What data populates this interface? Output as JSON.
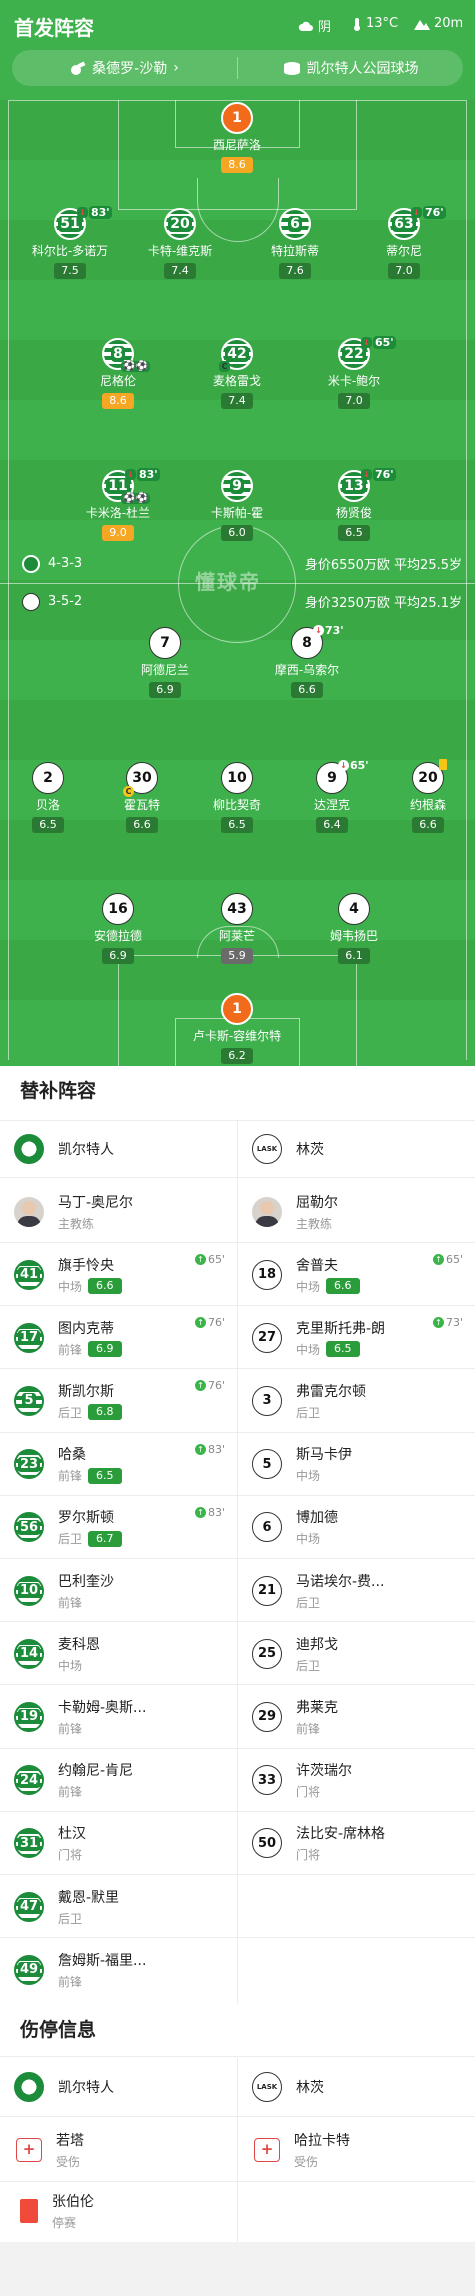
{
  "header": {
    "title": "首发阵容",
    "weather": "阴",
    "temperature": "13°C",
    "wind": "20m"
  },
  "info": {
    "referee": "桑德罗-沙勒",
    "stadium": "凯尔特人公园球场"
  },
  "watermark": "懂球帝",
  "home": {
    "formation": "4-3-3",
    "meta": "身价6550万欧  平均25.5岁",
    "players": [
      {
        "num": "1",
        "name": "西尼萨洛",
        "rating": "8.6",
        "best": true,
        "gk": true
      },
      {
        "num": "51",
        "name": "科尔比-多诺万",
        "rating": "7.5",
        "sub": "83'"
      },
      {
        "num": "20",
        "name": "卡特-维克斯",
        "rating": "7.4"
      },
      {
        "num": "6",
        "name": "特拉斯蒂",
        "rating": "7.6"
      },
      {
        "num": "63",
        "name": "蒂尔尼",
        "rating": "7.0",
        "sub": "76'"
      },
      {
        "num": "8",
        "name": "尼格伦",
        "rating": "8.6",
        "best": true
      },
      {
        "num": "42",
        "name": "麦格雷戈",
        "rating": "7.4"
      },
      {
        "num": "22",
        "name": "米卡-鲍尔",
        "rating": "7.0",
        "sub": "65'"
      },
      {
        "num": "11",
        "name": "卡米洛-杜兰",
        "rating": "9.0",
        "best": true,
        "sub": "83'"
      },
      {
        "num": "9",
        "name": "卡斯帕-霍",
        "rating": "6.0"
      },
      {
        "num": "13",
        "name": "杨贤俊",
        "rating": "6.5",
        "sub": "76'"
      }
    ]
  },
  "away": {
    "formation": "3-5-2",
    "meta": "身价3250万欧  平均25.1岁",
    "players": [
      {
        "num": "7",
        "name": "阿德尼兰",
        "rating": "6.9"
      },
      {
        "num": "8",
        "name": "摩西-乌索尔",
        "rating": "6.6",
        "sub": "73'"
      },
      {
        "num": "2",
        "name": "贝洛",
        "rating": "6.5"
      },
      {
        "num": "30",
        "name": "霍瓦特",
        "rating": "6.6"
      },
      {
        "num": "10",
        "name": "柳比契奇",
        "rating": "6.5"
      },
      {
        "num": "9",
        "name": "达涅克",
        "rating": "6.4",
        "sub": "65'"
      },
      {
        "num": "20",
        "name": "约根森",
        "rating": "6.6"
      },
      {
        "num": "16",
        "name": "安德拉德",
        "rating": "6.9"
      },
      {
        "num": "43",
        "name": "阿莱芒",
        "rating": "5.9",
        "low": true
      },
      {
        "num": "4",
        "name": "姆韦扬巴",
        "rating": "6.1"
      },
      {
        "num": "1",
        "name": "卢卡斯-容维尔特",
        "rating": "6.2",
        "gk": true
      }
    ]
  },
  "subs": {
    "title": "替补阵容",
    "home_team": "凯尔特人",
    "away_team": "林茨",
    "away_logo_text": "LASK",
    "home_coach": {
      "name": "马丁-奥尼尔",
      "role": "主教练"
    },
    "away_coach": {
      "name": "屈勒尔",
      "role": "主教练"
    },
    "home": [
      {
        "num": "41",
        "name": "旗手怜央",
        "pos": "中场",
        "rating": "6.6",
        "in": "65'"
      },
      {
        "num": "17",
        "name": "图内克蒂",
        "pos": "前锋",
        "rating": "6.9",
        "in": "76'"
      },
      {
        "num": "5",
        "name": "斯凯尔斯",
        "pos": "后卫",
        "rating": "6.8",
        "in": "76'"
      },
      {
        "num": "23",
        "name": "哈桑",
        "pos": "前锋",
        "rating": "6.5",
        "in": "83'"
      },
      {
        "num": "56",
        "name": "罗尔斯顿",
        "pos": "后卫",
        "rating": "6.7",
        "in": "83'"
      },
      {
        "num": "10",
        "name": "巴利奎沙",
        "pos": "前锋"
      },
      {
        "num": "14",
        "name": "麦科恩",
        "pos": "中场"
      },
      {
        "num": "19",
        "name": "卡勒姆-奥斯...",
        "pos": "前锋"
      },
      {
        "num": "24",
        "name": "约翰尼-肯尼",
        "pos": "前锋"
      },
      {
        "num": "31",
        "name": "杜汉",
        "pos": "门将"
      },
      {
        "num": "47",
        "name": "戴恩-默里",
        "pos": "后卫"
      },
      {
        "num": "49",
        "name": "詹姆斯-福里...",
        "pos": "前锋"
      }
    ],
    "away": [
      {
        "num": "18",
        "name": "舍普夫",
        "pos": "中场",
        "rating": "6.6",
        "in": "65'"
      },
      {
        "num": "27",
        "name": "克里斯托弗-朗",
        "pos": "中场",
        "rating": "6.5",
        "in": "73'"
      },
      {
        "num": "3",
        "name": "弗雷克尔顿",
        "pos": "后卫"
      },
      {
        "num": "5",
        "name": "斯马卡伊",
        "pos": "中场"
      },
      {
        "num": "6",
        "name": "博加德",
        "pos": "中场"
      },
      {
        "num": "21",
        "name": "马诺埃尔-费...",
        "pos": "后卫"
      },
      {
        "num": "25",
        "name": "迪邦戈",
        "pos": "后卫"
      },
      {
        "num": "29",
        "name": "弗莱克",
        "pos": "前锋"
      },
      {
        "num": "33",
        "name": "许茨瑞尔",
        "pos": "门将"
      },
      {
        "num": "50",
        "name": "法比安-席林格",
        "pos": "门将"
      }
    ]
  },
  "injuries": {
    "title": "伤停信息",
    "home_team": "凯尔特人",
    "away_team": "林茨",
    "home": [
      {
        "name": "若塔",
        "status": "受伤"
      },
      {
        "name": "张伯伦",
        "status": "停赛"
      }
    ],
    "away": [
      {
        "name": "哈拉卡特",
        "status": "受伤"
      }
    ]
  }
}
